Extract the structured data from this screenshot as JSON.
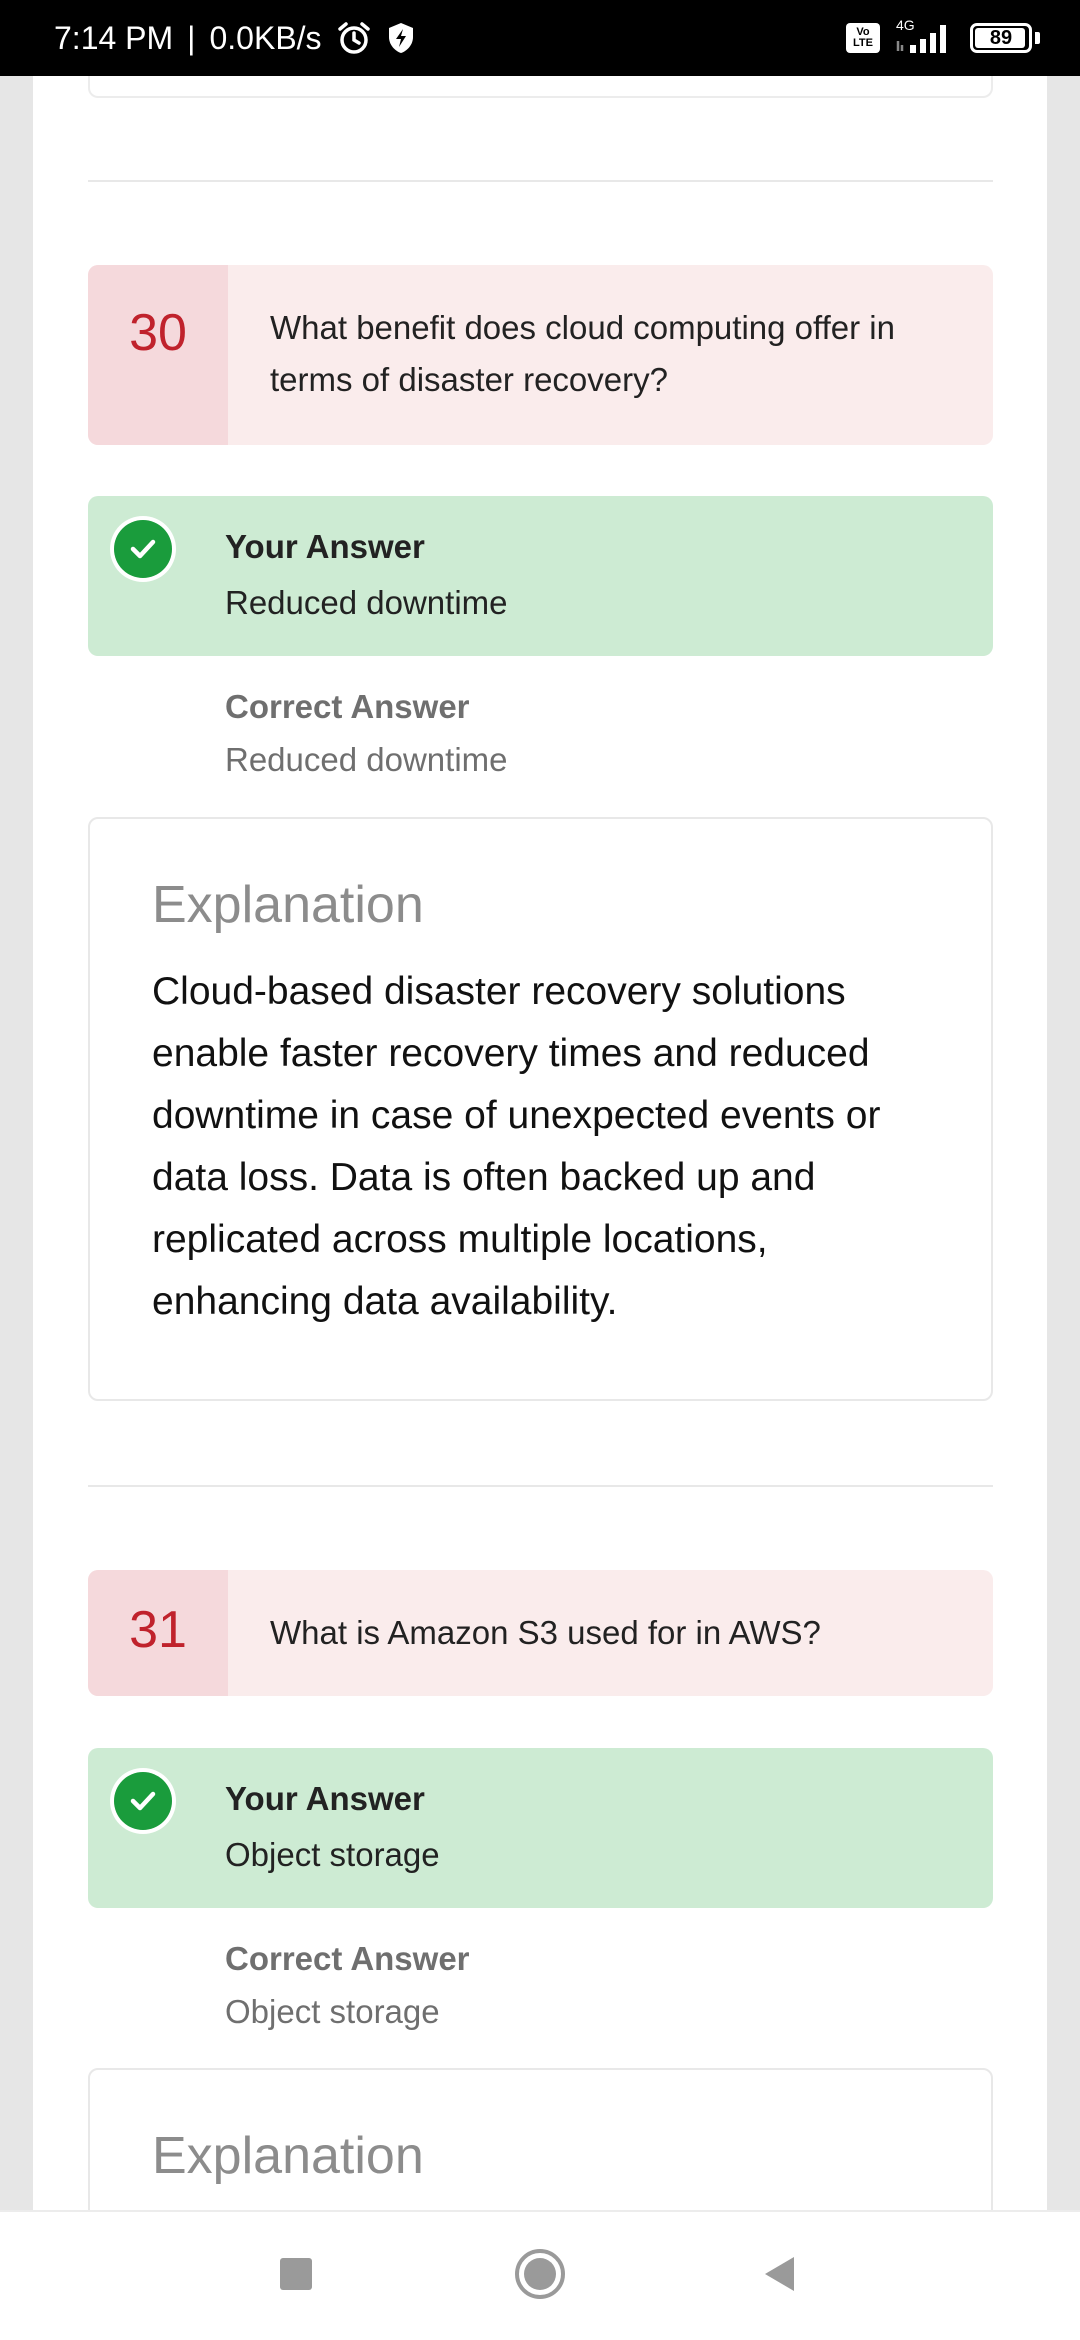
{
  "status_bar": {
    "time": "7:14 PM",
    "separator": "|",
    "net_speed": "0.0KB/s",
    "volte_top": "Vo",
    "volte_bottom": "LTE",
    "network_type": "4G",
    "battery": "89"
  },
  "questions": [
    {
      "number": "30",
      "text": "What benefit does cloud computing offer in terms of disaster recovery?",
      "your_answer_label": "Your Answer",
      "your_answer": "Reduced downtime",
      "correct_answer_label": "Correct Answer",
      "correct_answer": "Reduced downtime",
      "explanation_title": "Explanation",
      "explanation": "Cloud-based disaster recovery solutions enable faster recovery times and reduced downtime in case of unexpected events or data loss. Data is often backed up and replicated across multiple locations, enhancing data availability."
    },
    {
      "number": "31",
      "text": "What is Amazon S3 used for in AWS?",
      "your_answer_label": "Your Answer",
      "your_answer": "Object storage",
      "correct_answer_label": "Correct Answer",
      "correct_answer": "Object storage",
      "explanation_title": "Explanation"
    }
  ],
  "colors": {
    "question_bg": "#faecec",
    "question_number": "#c0222c",
    "answer_correct_bg": "#cdebd3",
    "check_green": "#1a9c3c"
  },
  "nav": {
    "recents_icon": "square-icon",
    "home_icon": "circle-icon",
    "back_icon": "triangle-back-icon"
  }
}
